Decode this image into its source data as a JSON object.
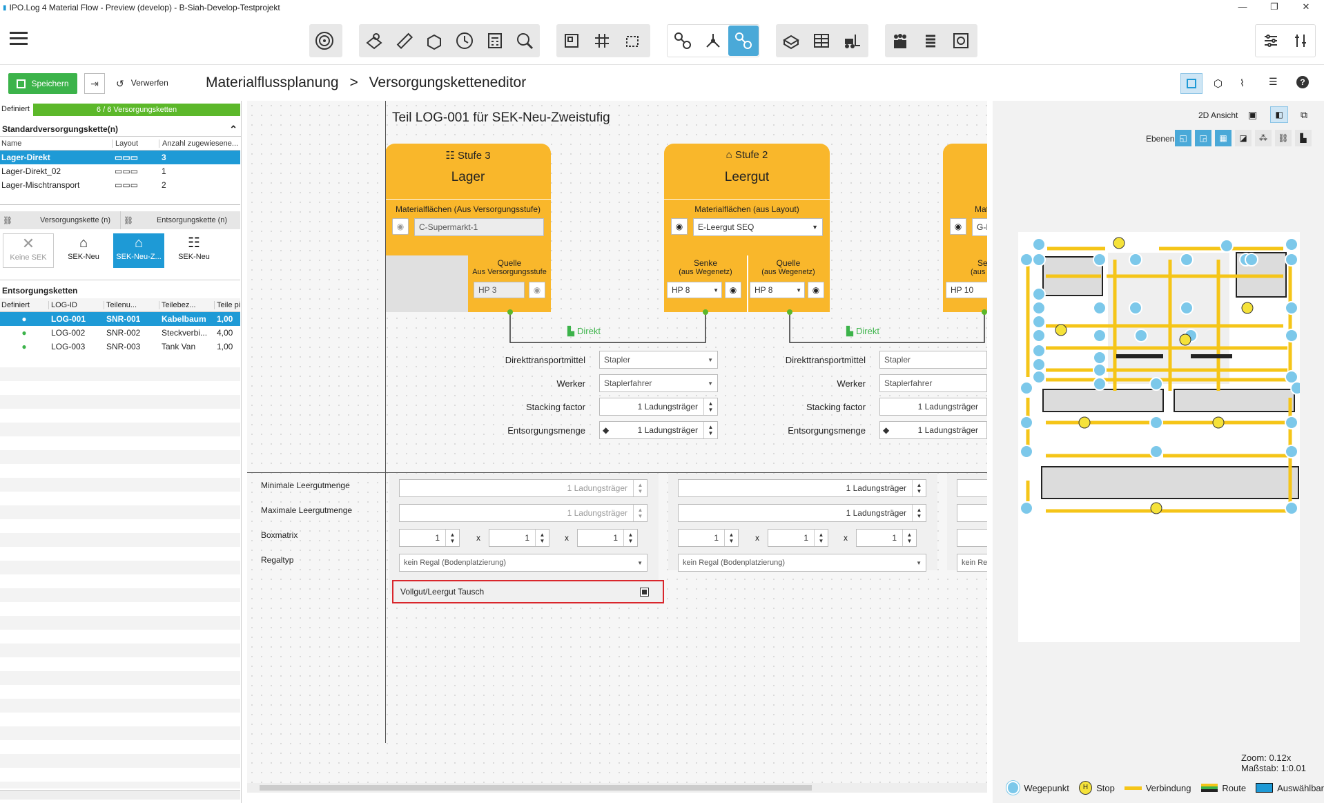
{
  "window": {
    "title": "IPO.Log 4 Material Flow - Preview (develop) - B-Siah-Develop-Testprojekt"
  },
  "colors": {
    "accent": "#1e9ad6",
    "save": "#3cb34a",
    "stage": "#f9b72b",
    "route": "#f5c518"
  },
  "toolbar": {
    "save": "Speichern",
    "discard": "Verwerfen"
  },
  "breadcrumb": {
    "part1": "Materialflussplanung",
    "sep": ">",
    "part2": "Versorgungsketteneditor"
  },
  "left": {
    "defined_label": "Definiert",
    "progress": "6 / 6 Versorgungsketten",
    "std_title": "Standardversorgungskette(n)",
    "cols": [
      "Name",
      "Layout",
      "Anzahl zugewiesene..."
    ],
    "rows": [
      {
        "name": "Lager-Direkt",
        "count": "3"
      },
      {
        "name": "Lager-Direkt_02",
        "count": "1"
      },
      {
        "name": "Lager-Mischtransport",
        "count": "2"
      }
    ],
    "tab_supply": "Versorgungskette (n)",
    "tab_disposal": "Entsorgungskette (n)",
    "sek": [
      {
        "label": "Keine SEK"
      },
      {
        "label": "SEK-Neu"
      },
      {
        "label": "SEK-Neu-Z..."
      },
      {
        "label": "SEK-Neu"
      }
    ],
    "disp_title": "Entsorgungsketten",
    "disp_cols": [
      "Definiert",
      "LOG-ID",
      "Teilenu...",
      "Teilebez...",
      "Teile pi"
    ],
    "disp_rows": [
      {
        "id": "LOG-001",
        "nr": "SNR-001",
        "desc": "Kabelbaum",
        "val": "1,00"
      },
      {
        "id": "LOG-002",
        "nr": "SNR-002",
        "desc": "Steckverbi...",
        "val": "4,00"
      },
      {
        "id": "LOG-003",
        "nr": "SNR-003",
        "desc": "Tank Van",
        "val": "1,00"
      }
    ]
  },
  "main": {
    "title": "Teil LOG-001 für SEK-Neu-Zweistufig",
    "stage3": {
      "stage": "Stufe 3",
      "name": "Lager",
      "areas": "Materialflächen (Aus Versorgungsstufe)",
      "area_value": "C-Supermarkt-1",
      "source": "Quelle",
      "source_sub": "Aus Versorgungsstufe",
      "hp": "HP 3"
    },
    "stage2": {
      "stage": "Stufe 2",
      "name": "Leergut",
      "areas": "Materialflächen (aus Layout)",
      "area_value": "E-Leergut SEQ",
      "sink": "Senke",
      "sink_sub": "(aus Wegenetz)",
      "source": "Quelle",
      "source_sub": "(aus Wegenetz)",
      "hp1": "HP 8",
      "hp2": "HP 8"
    },
    "stage1": {
      "areas": "Mate",
      "area_value": "G-Le",
      "sink": "Sen",
      "sink_sub": "(aus Weg",
      "hp": "HP 10"
    },
    "direct": "Direkt",
    "params": {
      "transport": "Direkttransportmittel",
      "worker": "Werker",
      "stacking": "Stacking factor",
      "amount": "Entsorgungsmenge"
    },
    "values": {
      "stapler": "Stapler",
      "staplerfahrer": "Staplerfahrer",
      "one_lt": "1 Ladungsträger"
    },
    "lower": {
      "min": "Minimale Leergutmenge",
      "max": "Maximale Leergutmenge",
      "box": "Boxmatrix",
      "rack": "Regaltyp",
      "one_lt": "1 Ladungsträger",
      "one": "1",
      "x": "x",
      "rack_val": "kein Regal (Bodenplatzierung)",
      "rack_short": "kein Reg",
      "swap": "Vollgut/Leergut Tausch"
    }
  },
  "right": {
    "view": "2D Ansicht",
    "layers": "Ebenen",
    "zoom": "Zoom: 0.12x",
    "scale": "Maßstab: 1:0.01",
    "legend": {
      "wp": "Wegepunkt",
      "stop": "Stop",
      "conn": "Verbindung",
      "route": "Route",
      "sel": "Auswählbar"
    },
    "h": "H"
  }
}
